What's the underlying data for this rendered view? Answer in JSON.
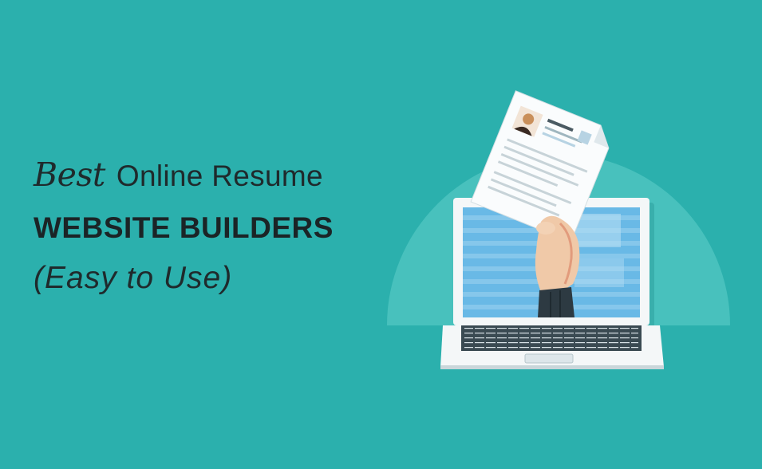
{
  "headline": {
    "line1_script": "Best",
    "line1_rest": "Online Resume",
    "line2": "WEBSITE BUILDERS",
    "line3": "(Easy to Use)"
  },
  "colors": {
    "background": "#2bb0ad",
    "halo": "#4dc4bf",
    "text": "#1f2a2c",
    "screen": "#69b9e6",
    "laptop_body": "#f4f7f8",
    "keyboard": "#3a4a52"
  },
  "icons": {
    "illustration": "laptop-with-hand-holding-resume"
  }
}
